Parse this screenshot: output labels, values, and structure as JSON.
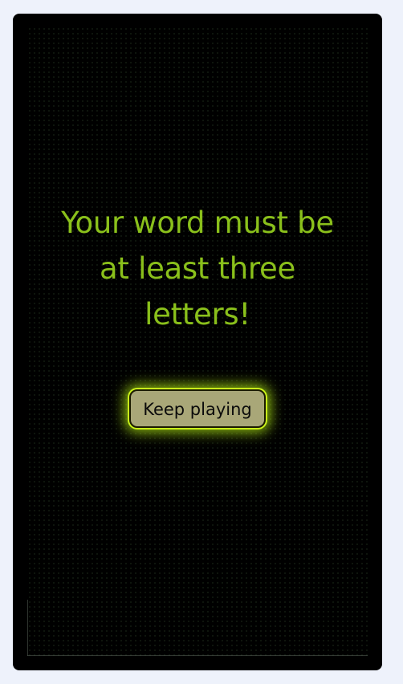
{
  "message": {
    "text": "Your word must be at least three letters!"
  },
  "button": {
    "label": "Keep playing"
  },
  "colors": {
    "background": "#000000",
    "text_accent": "#8ac01b",
    "button_fill": "#a9a778",
    "button_glow": "#c9f21a",
    "page_bg": "#eef2fb"
  }
}
